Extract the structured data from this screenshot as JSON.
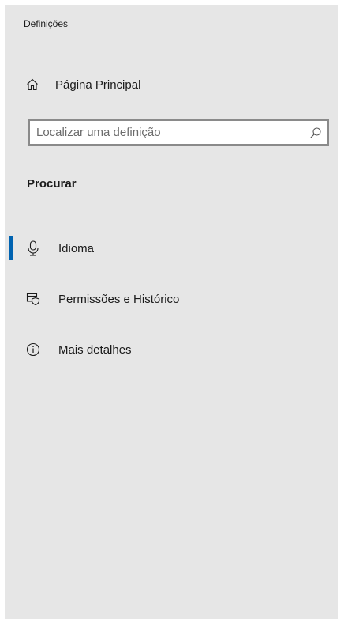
{
  "window": {
    "title": "Definições"
  },
  "home": {
    "icon": "home-icon",
    "label": "Página Principal"
  },
  "search": {
    "placeholder": "Localizar uma definição",
    "value": "",
    "icon": "search-icon"
  },
  "section": {
    "heading": "Procurar"
  },
  "nav": {
    "items": [
      {
        "label": "Idioma",
        "icon": "microphone-icon",
        "selected": true
      },
      {
        "label": "Permissões e Histórico",
        "icon": "shield-permissions-icon",
        "selected": false
      },
      {
        "label": "Mais detalhes",
        "icon": "info-icon",
        "selected": false
      }
    ]
  },
  "colors": {
    "panel_background": "#e6e6e6",
    "accent": "#0063b1",
    "search_border": "#8a8a8a"
  }
}
